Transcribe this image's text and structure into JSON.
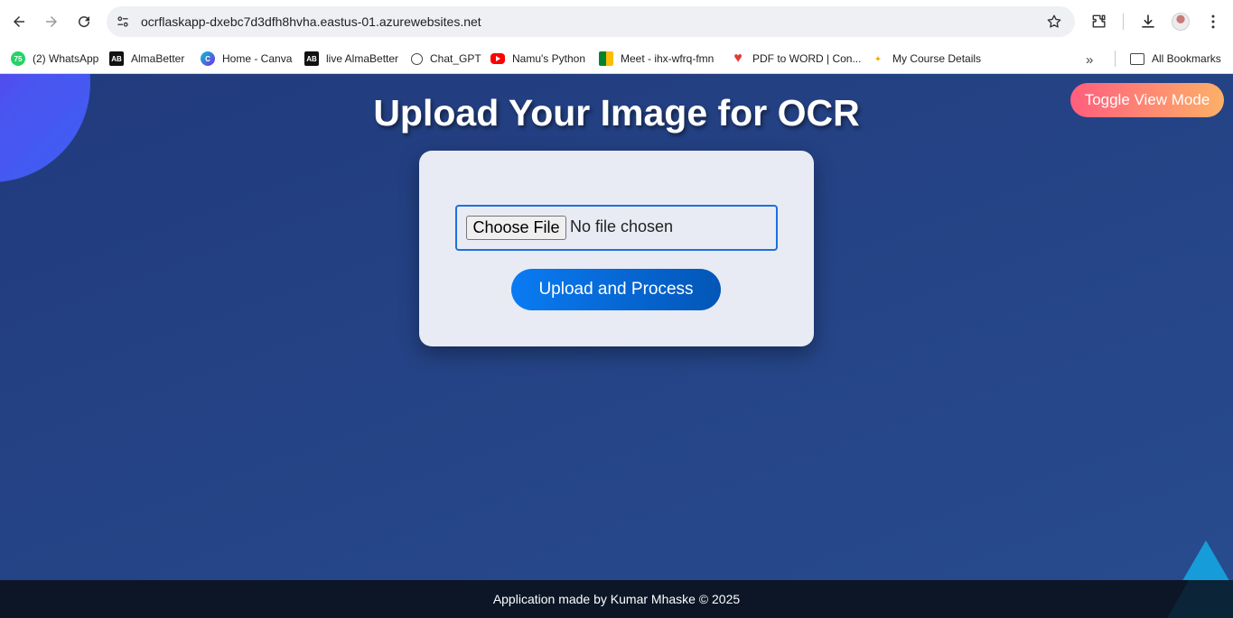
{
  "browser": {
    "url": "ocrflaskapp-dxebc7d3dfh8hvha.eastus-01.azurewebsites.net",
    "icons": [
      "back-icon",
      "forward-icon",
      "reload-icon",
      "site-settings-icon",
      "star-icon",
      "extensions-icon",
      "download-icon",
      "profile-avatar",
      "menu-icon"
    ],
    "bookmarks": [
      {
        "label": "(2) WhatsApp",
        "icon": "whatsapp-icon",
        "badge": "75"
      },
      {
        "label": "AlmaBetter",
        "icon": "almabetter-icon",
        "badge": "AB"
      },
      {
        "label": "Home - Canva",
        "icon": "canva-icon",
        "badge": "C"
      },
      {
        "label": "live AlmaBetter",
        "icon": "almabetter-icon",
        "badge": "AB"
      },
      {
        "label": "Chat_GPT",
        "icon": "chatgpt-icon",
        "badge": ""
      },
      {
        "label": "Namu's Python",
        "icon": "youtube-icon",
        "badge": ""
      },
      {
        "label": "Meet - ihx-wfrq-fmn",
        "icon": "meet-icon",
        "badge": ""
      },
      {
        "label": "PDF to WORD | Con...",
        "icon": "pdf-icon",
        "badge": ""
      },
      {
        "label": "My Course Details",
        "icon": "course-icon",
        "badge": "✦"
      }
    ],
    "all_bookmarks": "All Bookmarks"
  },
  "page": {
    "toggle_label": "Toggle View Mode",
    "title": "Upload Your Image for OCR",
    "file_input": {
      "button_label": "Choose File",
      "status": "No file chosen"
    },
    "upload_label": "Upload and Process",
    "footer": "Application made by Kumar Mhaske © 2025"
  },
  "colors": {
    "page_bg": "#213b7d",
    "toggle_gradient": [
      "#ff5e7e",
      "#fdb067"
    ],
    "upload_gradient": [
      "#0a7bf3",
      "#0356b7"
    ],
    "card_bg": "#e8ebf3",
    "footer_bg": "#0c1626"
  }
}
